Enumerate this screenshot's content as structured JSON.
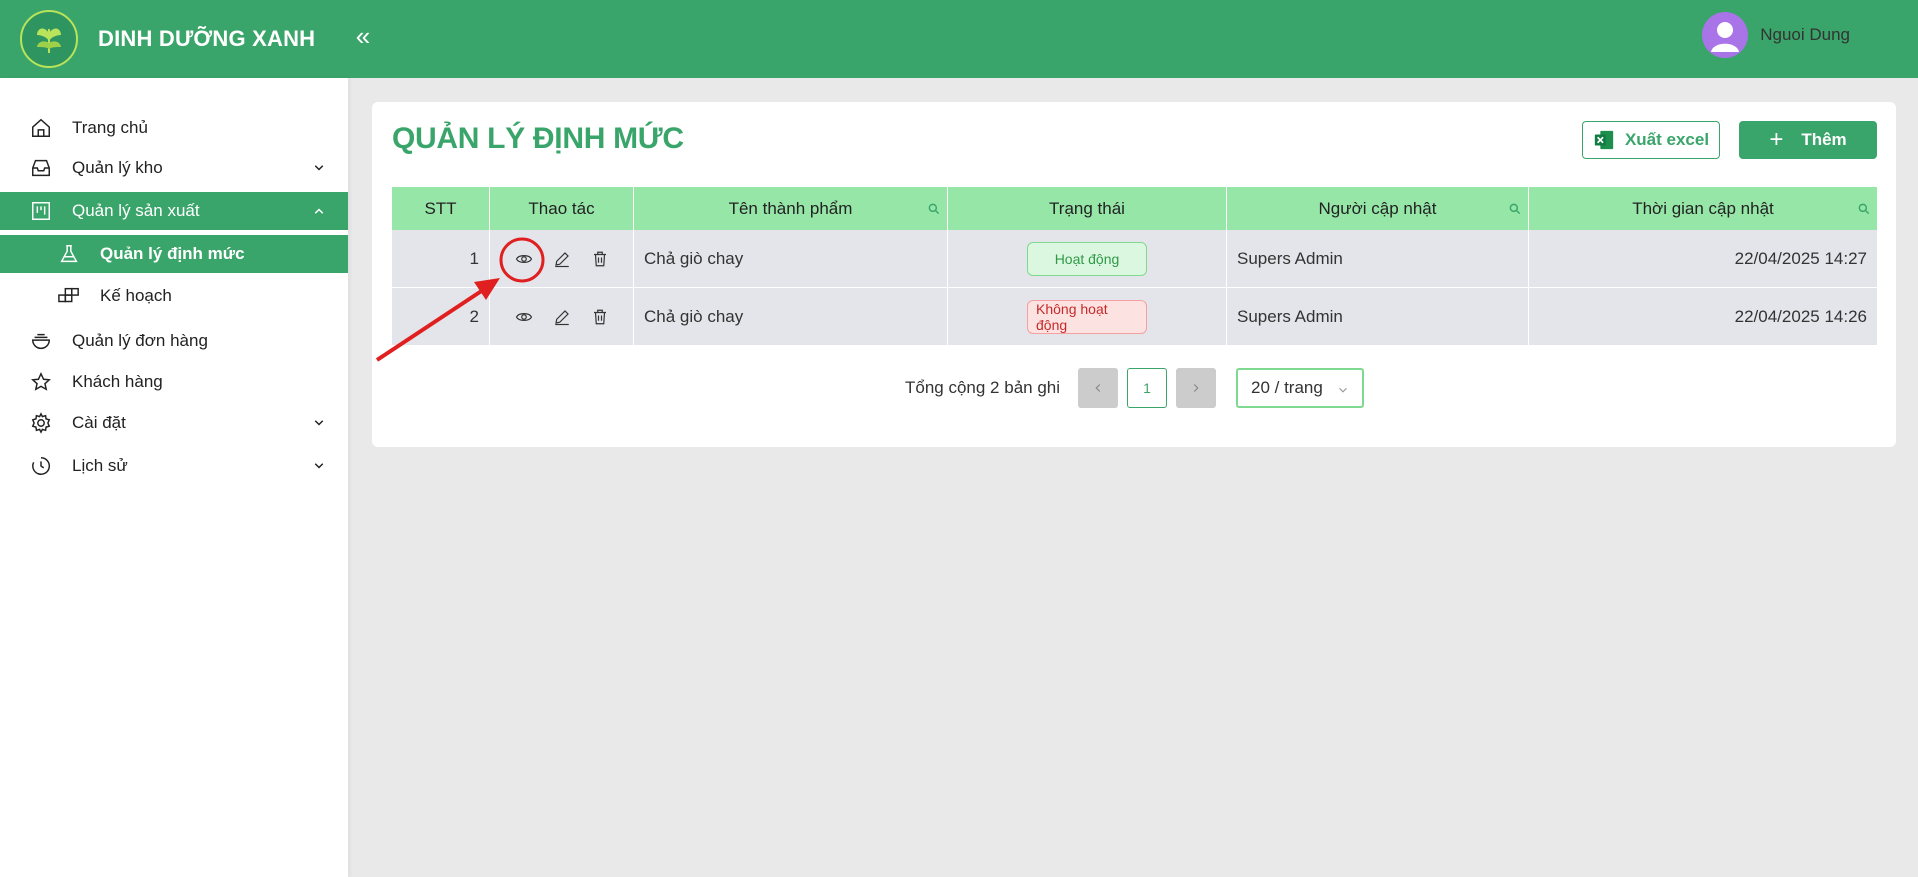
{
  "header": {
    "brand_title": "DINH DƯỠNG XANH",
    "user_name": "Nguoi Dung"
  },
  "sidebar": {
    "items": [
      {
        "label": "Trang chủ",
        "icon": "home-icon"
      },
      {
        "label": "Quản lý kho",
        "icon": "inbox-icon",
        "expandable": true
      },
      {
        "label": "Quản lý sản xuất",
        "icon": "project-icon",
        "expandable": true,
        "expanded": true,
        "active": true
      },
      {
        "label": "Quản lý định mức",
        "icon": "flask-icon",
        "active": true
      },
      {
        "label": "Kế hoạch",
        "icon": "blocks-icon"
      },
      {
        "label": "Quản lý đơn hàng",
        "icon": "bowl-icon"
      },
      {
        "label": "Khách hàng",
        "icon": "star-icon"
      },
      {
        "label": "Cài đặt",
        "icon": "gear-icon",
        "expandable": true
      },
      {
        "label": "Lịch sử",
        "icon": "history-icon",
        "expandable": true
      }
    ]
  },
  "main": {
    "title": "QUẢN LÝ ĐỊNH MỨC",
    "excel_label": "Xuất excel",
    "add_label": "Thêm"
  },
  "table": {
    "headers": [
      "STT",
      "Thao tác",
      "Tên thành phẩm",
      "Trạng thái",
      "Người cập nhật",
      "Thời gian cập nhật"
    ],
    "rows": [
      {
        "stt": "1",
        "name": "Chả giò chay",
        "status": "Hoạt động",
        "status_color": "#2e9a48",
        "updater": "Supers Admin",
        "time": "22/04/2025 14:27"
      },
      {
        "stt": "2",
        "name": "Chả giò chay",
        "status": "Không hoạt động",
        "status_color": "#c52a2a",
        "updater": "Supers Admin",
        "time": "22/04/2025 14:26"
      }
    ]
  },
  "pagination": {
    "total_text": "Tổng cộng 2 bản ghi",
    "current_page": "1",
    "page_size": "20 / trang"
  },
  "colors": {
    "brand": "#3aa56a",
    "header_row": "#96e6a8",
    "annotation": "#e02020"
  }
}
